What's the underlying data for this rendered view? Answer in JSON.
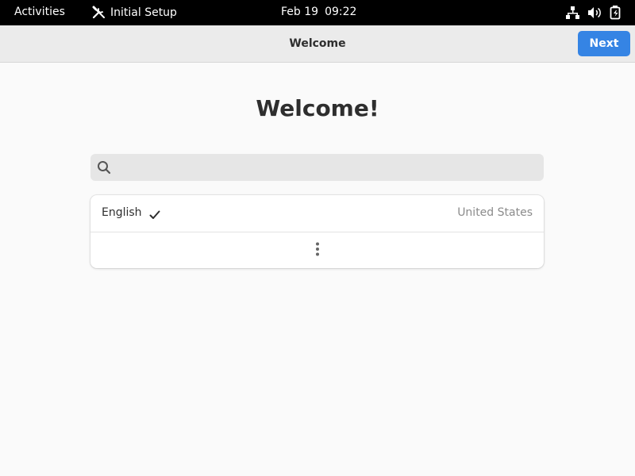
{
  "topbar": {
    "activities": "Activities",
    "app_name": "Initial Setup",
    "app_icon": "tools-icon",
    "date": "Feb 19",
    "time": "09:22",
    "status_icons": [
      "network-wired-icon",
      "volume-icon",
      "battery-icon"
    ]
  },
  "header": {
    "title": "Welcome",
    "next_label": "Next"
  },
  "main": {
    "heading": "Welcome!",
    "search": {
      "value": "",
      "placeholder": ""
    },
    "languages": [
      {
        "language": "English",
        "selected": true,
        "region": "United States"
      }
    ],
    "more_icon": "view-more-icon"
  },
  "colors": {
    "accent": "#3584e4",
    "topbar_bg": "#000000",
    "headerbar_bg": "#ebebeb",
    "window_bg": "#fafafa"
  }
}
